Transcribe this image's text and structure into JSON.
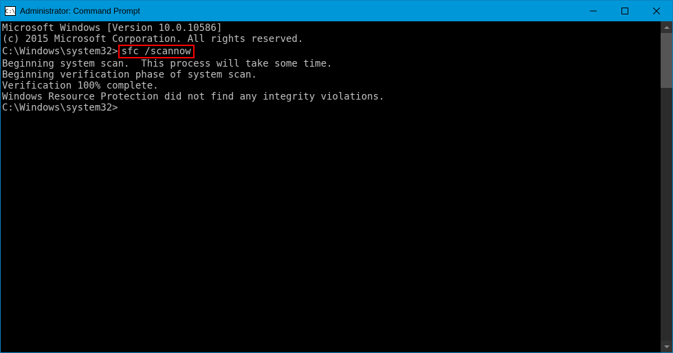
{
  "window": {
    "title": "Administrator: Command Prompt",
    "icon_text": "C:\\"
  },
  "terminal": {
    "line1": "Microsoft Windows [Version 10.0.10586]",
    "line2": "(c) 2015 Microsoft Corporation. All rights reserved.",
    "blank1": "",
    "prompt1": "C:\\Windows\\system32>",
    "command1": "sfc /scannow",
    "blank2": "",
    "line3": "Beginning system scan.  This process will take some time.",
    "blank3": "",
    "line4": "Beginning verification phase of system scan.",
    "line5": "Verification 100% complete.",
    "blank4": "",
    "line6": "Windows Resource Protection did not find any integrity violations.",
    "blank5": "",
    "prompt2": "C:\\Windows\\system32>"
  }
}
